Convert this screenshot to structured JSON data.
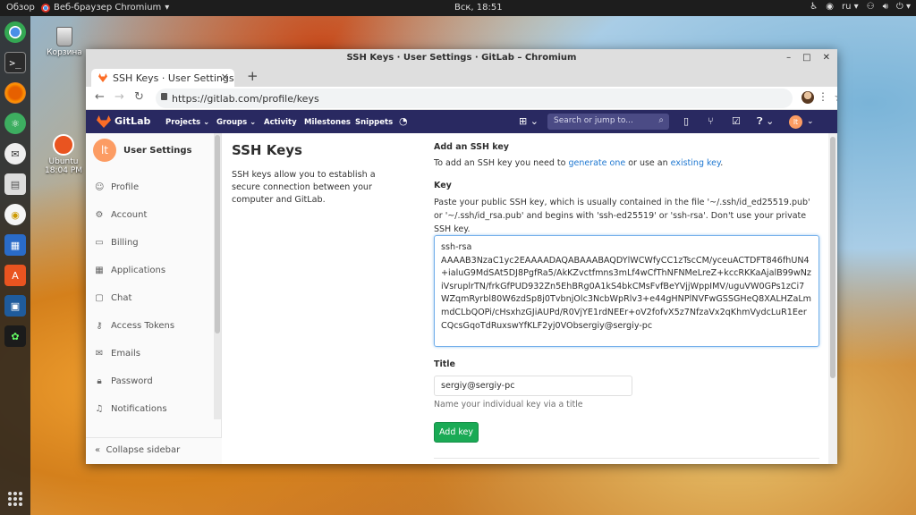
{
  "topbar": {
    "activities": "Обзор",
    "app_name": "Веб-браузер Chromium",
    "clock": "Вск, 18:51",
    "lang": "ru"
  },
  "desktop": {
    "trash_label": "Корзина",
    "ubuntu_label": "Ubuntu",
    "ubuntu_time": "18:04 PM"
  },
  "window": {
    "title": "SSH Keys · User Settings · GitLab – Chromium",
    "tab_title": "SSH Keys · User Settings",
    "url": "https://gitlab.com/profile/keys"
  },
  "gitlab_nav": {
    "brand": "GitLab",
    "projects": "Projects",
    "groups": "Groups",
    "activity": "Activity",
    "milestones": "Milestones",
    "snippets": "Snippets",
    "search_placeholder": "Search or jump to...",
    "user_initials": "lt"
  },
  "sidebar": {
    "avatar_initials": "lt",
    "title": "User Settings",
    "items": [
      {
        "label": "Profile",
        "icon": "profile-icon"
      },
      {
        "label": "Account",
        "icon": "account-icon"
      },
      {
        "label": "Billing",
        "icon": "billing-icon"
      },
      {
        "label": "Applications",
        "icon": "applications-icon"
      },
      {
        "label": "Chat",
        "icon": "chat-icon"
      },
      {
        "label": "Access Tokens",
        "icon": "key-icon"
      },
      {
        "label": "Emails",
        "icon": "email-icon"
      },
      {
        "label": "Password",
        "icon": "lock-icon"
      },
      {
        "label": "Notifications",
        "icon": "bell-icon"
      }
    ],
    "collapse": "Collapse sidebar"
  },
  "content": {
    "heading": "SSH Keys",
    "description": "SSH keys allow you to establish a secure connection between your computer and GitLab.",
    "add_heading": "Add an SSH key",
    "add_text_1": "To add an SSH key you need to ",
    "generate_link": "generate one",
    "add_text_2": " or use an ",
    "existing_link": "existing key",
    "add_text_3": ".",
    "key_label": "Key",
    "key_help": "Paste your public SSH key, which is usually contained in the file '~/.ssh/id_ed25519.pub' or '~/.ssh/id_rsa.pub' and begins with 'ssh-ed25519' or 'ssh-rsa'. Don't use your private SSH key.",
    "key_value": "ssh-rsa\nAAAAB3NzaC1yc2EAAAADAQABAAABAQDYlWCWfyCC1zTscCM/yceuACTDFT846fhUN4+ialuG9MdSAt5DJ8PgfRa5/AkKZvctfmns3mLf4wCfThNFNMeLreZ+kccRKKaAjalB99wNziVsruplrTN/frkGfPUD932Zn5EhBRg0A1kS4bkCMsFvfBeYVjjWppIMV/uguVW0GPs1zCi7WZqmRyrbl80W6zdSp8j0TvbnjOlc3NcbWpRlv3+e44gHNPlNVFwGSSGHeQ8XALHZaLmmdCLbQOPi/cHsxhzGJiAUPd/R0VjYE1rdNEEr+oV2fofvX5z7NfzaVx2qKhmVydcLuR1EerCQcsGqoTdRuxswYfKLF2yj0VObsergiy@sergiy-pc",
    "title_label": "Title",
    "title_value": "sergiy@sergiy-pc",
    "title_hint": "Name your individual key via a title",
    "add_button": "Add key"
  },
  "colors": {
    "gitlab_nav": "#292961",
    "accent_green": "#1aaa55",
    "link": "#1f78d1"
  }
}
